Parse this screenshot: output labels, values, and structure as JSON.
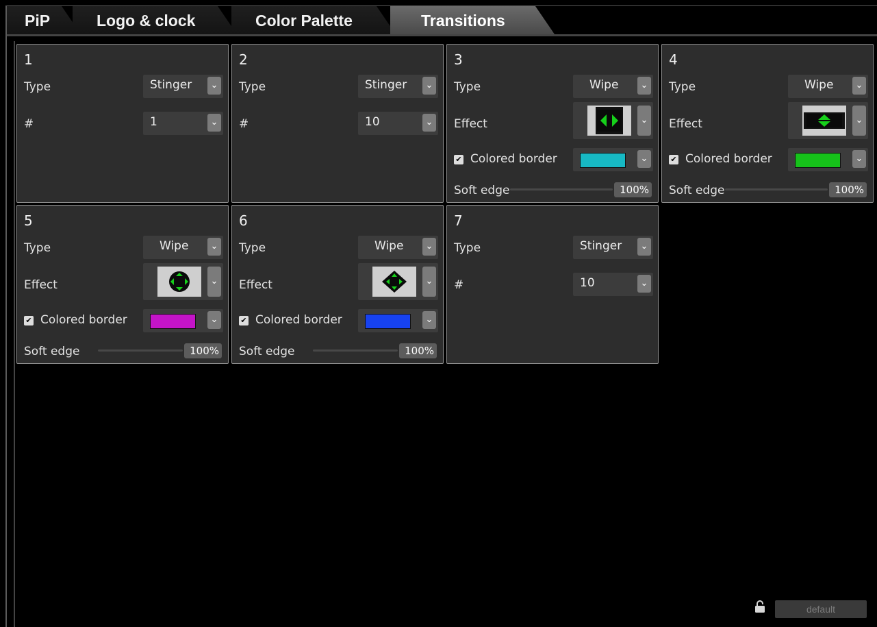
{
  "tabs": [
    {
      "label": "PiP",
      "active": false
    },
    {
      "label": "Logo & clock",
      "active": false
    },
    {
      "label": "Color Palette",
      "active": false
    },
    {
      "label": "Transitions",
      "active": true
    }
  ],
  "labels": {
    "type": "Type",
    "effect": "Effect",
    "hash": "#",
    "colored_border": "Colored border",
    "soft_edge": "Soft edge"
  },
  "panels": [
    {
      "number": "1",
      "type": "Stinger",
      "stinger_number": "1"
    },
    {
      "number": "2",
      "type": "Stinger",
      "stinger_number": "10"
    },
    {
      "number": "3",
      "type": "Wipe",
      "effect_icon": "horizontal-split-wipe-icon",
      "colored_border_checked": true,
      "border_color": "#17b9c4",
      "soft_edge": "100%",
      "soft_edge_value": 1.0
    },
    {
      "number": "4",
      "type": "Wipe",
      "effect_icon": "vertical-split-wipe-icon",
      "colored_border_checked": true,
      "border_color": "#16c21a",
      "soft_edge": "100%",
      "soft_edge_value": 1.0
    },
    {
      "number": "5",
      "type": "Wipe",
      "effect_icon": "circle-wipe-icon",
      "colored_border_checked": true,
      "border_color": "#c414c8",
      "soft_edge": "100%",
      "soft_edge_value": 1.0
    },
    {
      "number": "6",
      "type": "Wipe",
      "effect_icon": "diamond-wipe-icon",
      "colored_border_checked": true,
      "border_color": "#1742f0",
      "soft_edge": "100%",
      "soft_edge_value": 1.0
    },
    {
      "number": "7",
      "type": "Stinger",
      "stinger_number": "10"
    }
  ],
  "footer": {
    "lock_icon": "lock-icon",
    "default_label": "default"
  },
  "colors": {
    "effect_green": "#16d01a",
    "active_tab": "#5a5a5a"
  }
}
